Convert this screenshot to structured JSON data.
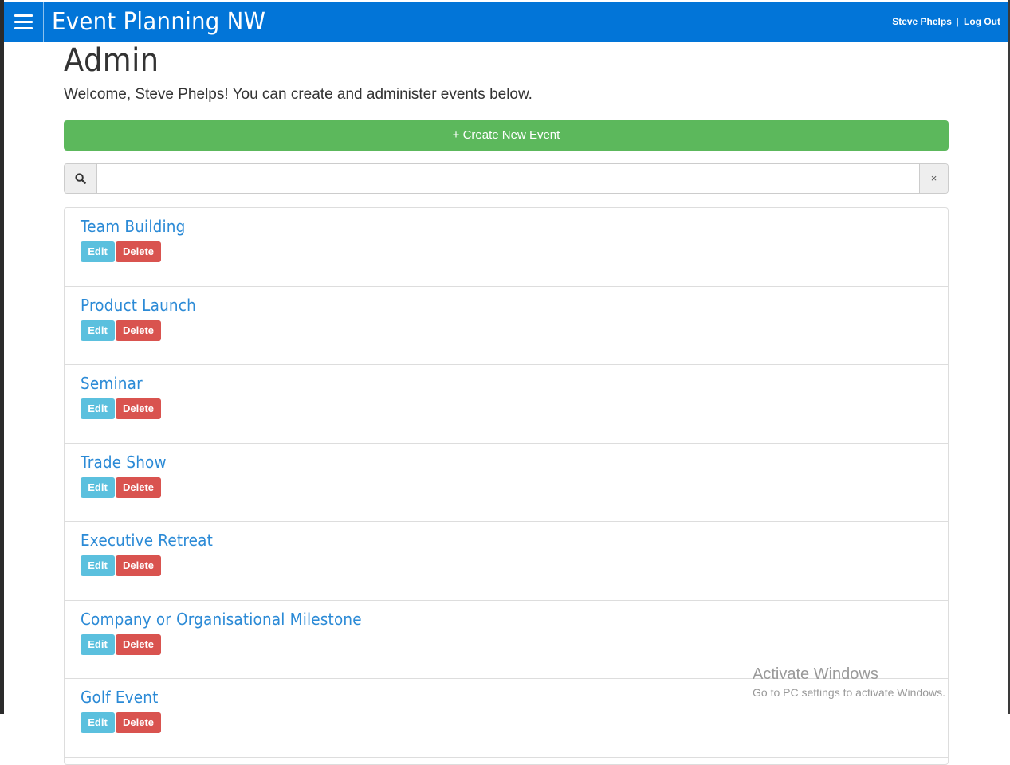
{
  "navbar": {
    "brand": "Event Planning NW",
    "user_name": "Steve Phelps",
    "separator": "|",
    "logout_label": "Log Out",
    "color": "#0275d8"
  },
  "page": {
    "title": "Admin",
    "welcome": "Welcome, Steve Phelps! You can create and administer events below."
  },
  "create_button": {
    "label": "+ Create New Event",
    "color": "#5cb85c"
  },
  "search": {
    "value": "",
    "placeholder": "",
    "clear_label": "×",
    "icon": "search-icon"
  },
  "events": [
    {
      "title": "Team Building",
      "edit_label": "Edit",
      "delete_label": "Delete"
    },
    {
      "title": "Product Launch",
      "edit_label": "Edit",
      "delete_label": "Delete"
    },
    {
      "title": "Seminar",
      "edit_label": "Edit",
      "delete_label": "Delete"
    },
    {
      "title": "Trade Show",
      "edit_label": "Edit",
      "delete_label": "Delete"
    },
    {
      "title": "Executive Retreat",
      "edit_label": "Edit",
      "delete_label": "Delete"
    },
    {
      "title": "Company or Organisational Milestone",
      "edit_label": "Edit",
      "delete_label": "Delete"
    },
    {
      "title": "Golf Event",
      "edit_label": "Edit",
      "delete_label": "Delete"
    }
  ],
  "watermark": {
    "title": "Activate Windows",
    "subtitle": "Go to PC settings to activate Windows."
  }
}
